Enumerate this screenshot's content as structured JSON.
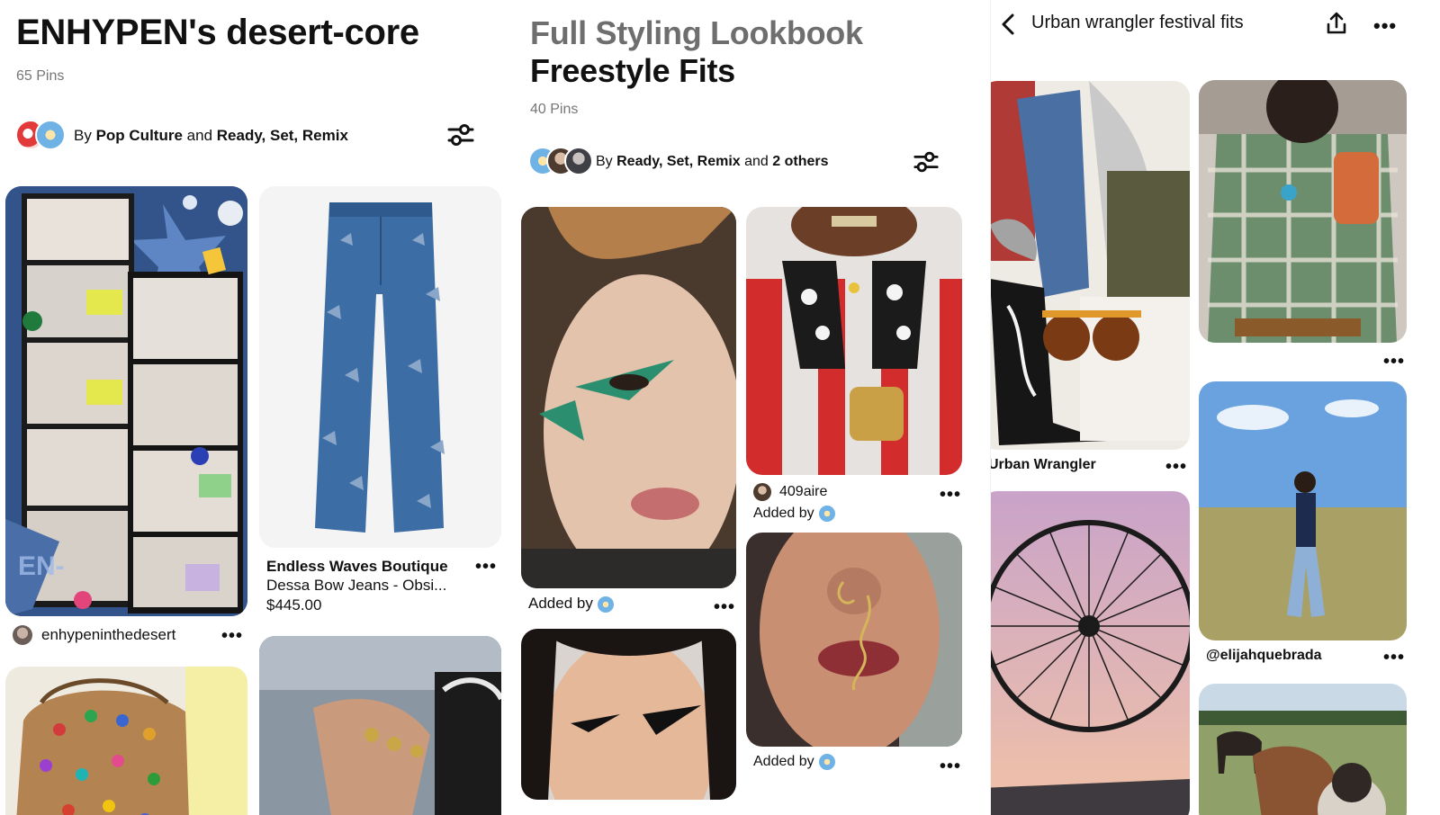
{
  "panel1": {
    "title": "ENHYPEN's desert-core",
    "pin_count": "65 Pins",
    "byline_prefix": "By",
    "byline_owner": "Pop Culture",
    "byline_and": "and",
    "byline_collab": "Ready, Set, Remix",
    "pins": [
      {
        "user": "enhypeninthedesert"
      },
      {
        "title": "Endless Waves Boutique",
        "subtitle": "Dessa Bow Jeans - Obsi...",
        "price": "$445.00"
      }
    ]
  },
  "panel2": {
    "title_line1": "Full Styling Lookbook",
    "title_line2": "Freestyle Fits",
    "pin_count": "40 Pins",
    "byline_prefix": "By",
    "byline_owner": "Ready, Set, Remix",
    "byline_and": "and",
    "byline_others": "2 others",
    "pins": [
      {
        "added_by": "Added by"
      },
      {
        "user": "409aire",
        "added_by": "Added by"
      },
      {
        "added_by": "Added by"
      }
    ]
  },
  "panel3": {
    "header_title": "Urban wrangler festival fits",
    "pins": [
      {
        "user": "Urban Wrangler"
      },
      {
        "user": "@elijahquebrada"
      }
    ]
  },
  "more_glyph": "•••",
  "icons": {
    "filter": "sliders-icon",
    "back": "chevron-left-icon",
    "share": "share-icon",
    "more": "more-horizontal-icon"
  },
  "colors": {
    "text_primary": "#111111",
    "text_secondary": "#767676",
    "title_muted": "#6e6e6e"
  }
}
